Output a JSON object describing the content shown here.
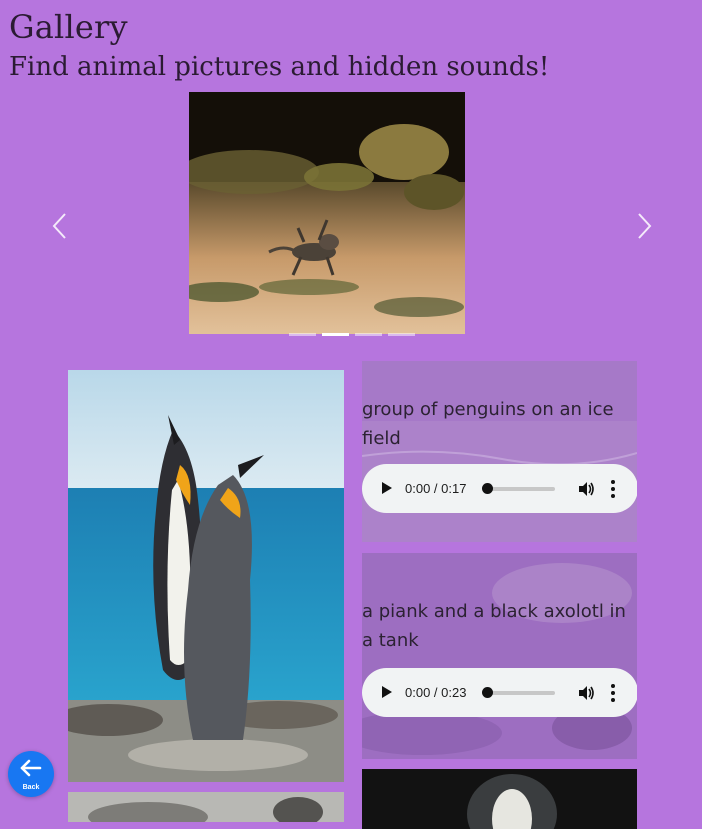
{
  "page": {
    "title": "Gallery",
    "subtitle": "Find animal pictures and hidden sounds!"
  },
  "carousel": {
    "image_alt": "axolotl walking on sand",
    "indicator_count": 4,
    "active_index": 1
  },
  "cards": [
    {
      "caption": "group of penguins on an ice field",
      "audio": {
        "time": "0:00 / 0:17",
        "progress": 0
      }
    },
    {
      "caption": "a piank and a black axolotl in a tank",
      "audio": {
        "time": "0:00 / 0:23",
        "progress": 0
      }
    }
  ],
  "back_button": {
    "label": "Back"
  },
  "colors": {
    "background": "#b675de",
    "back_button": "#1877f2",
    "audio_bg": "#f1f3f4"
  }
}
